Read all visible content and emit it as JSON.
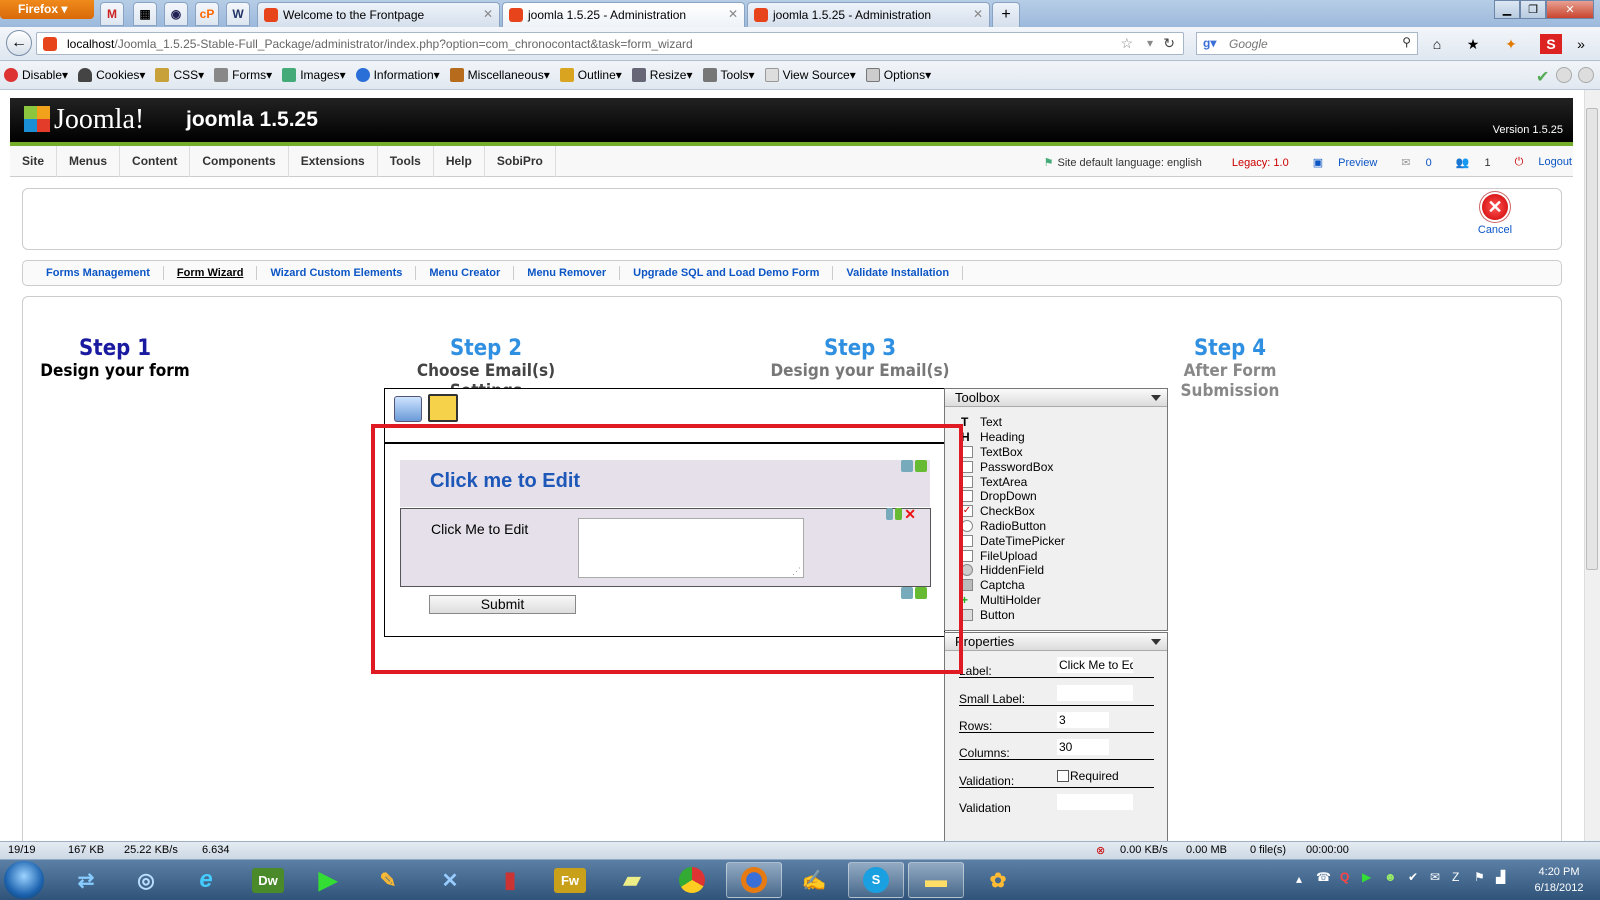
{
  "browser": {
    "app_button": "Firefox",
    "tabs": [
      {
        "title": "Welcome to the Frontpage",
        "active": false
      },
      {
        "title": "joomla 1.5.25 - Administration",
        "active": true
      },
      {
        "title": "joomla 1.5.25 - Administration",
        "active": false
      }
    ],
    "new_tab": "+",
    "url_host": "localhost",
    "url_path": "/Joomla_1.5.25-Stable-Full_Package/administrator/index.php?option=com_chronocontact&task=form_wizard",
    "search_placeholder": "Google",
    "webdev_toolbar": [
      "Disable",
      "Cookies",
      "CSS",
      "Forms",
      "Images",
      "Information",
      "Miscellaneous",
      "Outline",
      "Resize",
      "Tools",
      "View Source",
      "Options"
    ]
  },
  "joomla": {
    "logo": "Joomla!",
    "site_title": "joomla 1.5.25",
    "version": "Version 1.5.25",
    "menu": [
      "Site",
      "Menus",
      "Content",
      "Components",
      "Extensions",
      "Tools",
      "Help",
      "SobiPro"
    ],
    "status": {
      "language": "Site default language: english",
      "legacy": "Legacy: 1.0",
      "preview": "Preview",
      "messages": "0",
      "users": "1",
      "logout": "Logout"
    },
    "cancel_label": "Cancel",
    "submenu": [
      {
        "label": "Forms Management",
        "current": false
      },
      {
        "label": "Form Wizard",
        "current": true
      },
      {
        "label": "Wizard Custom Elements",
        "current": false
      },
      {
        "label": "Menu Creator",
        "current": false
      },
      {
        "label": "Menu Remover",
        "current": false
      },
      {
        "label": "Upgrade SQL and Load Demo Form",
        "current": false
      },
      {
        "label": "Validate Installation",
        "current": false
      }
    ]
  },
  "wizard": {
    "steps": [
      {
        "step": "Step 1",
        "desc": "Design your form",
        "step_color": "#1a1aa0",
        "desc_color": "#000000"
      },
      {
        "step": "Step 2",
        "desc": "Choose Email(s) Settings",
        "step_color": "#2f8fe0",
        "desc_color": "#444444"
      },
      {
        "step": "Step 3",
        "desc": "Design your Email(s)",
        "step_color": "#2f8fe0",
        "desc_color": "#777777"
      },
      {
        "step": "Step 4",
        "desc": "After Form Submission",
        "step_color": "#2f8fe0",
        "desc_color": "#888888"
      }
    ],
    "form": {
      "heading": "Click me to Edit",
      "field_label": "Click Me to Edit",
      "submit": "Submit"
    },
    "toolbox": {
      "title": "Toolbox",
      "items": [
        "Text",
        "Heading",
        "TextBox",
        "PasswordBox",
        "TextArea",
        "DropDown",
        "CheckBox",
        "RadioButton",
        "DateTimePicker",
        "FileUpload",
        "HiddenField",
        "Captcha",
        "MultiHolder",
        "Button"
      ]
    },
    "properties": {
      "title": "Properties",
      "rows": [
        {
          "label": "Label:",
          "value": "Click Me to Ed"
        },
        {
          "label": "Small Label:",
          "value": ""
        },
        {
          "label": "Rows:",
          "value": "3"
        },
        {
          "label": "Columns:",
          "value": "30"
        },
        {
          "label": "Validation:",
          "value": "Required"
        },
        {
          "label": "Validation",
          "value": ""
        }
      ]
    }
  },
  "statusbar": {
    "pages": "19/19",
    "size": "167 KB",
    "speed": "25.22 KB/s",
    "time": "6.634",
    "dl_speed": "0.00 KB/s",
    "dl_size": "0.00 MB",
    "files": "0 file(s)",
    "elapsed": "00:00:00"
  },
  "taskbar": {
    "apps": [
      "Dw",
      "Fw"
    ],
    "clock_time": "4:20 PM",
    "clock_date": "6/18/2012"
  },
  "colors": {
    "joomla_green": "#74ad2c",
    "link_blue": "#0b55c4",
    "highlight_red": "#e01a23"
  }
}
